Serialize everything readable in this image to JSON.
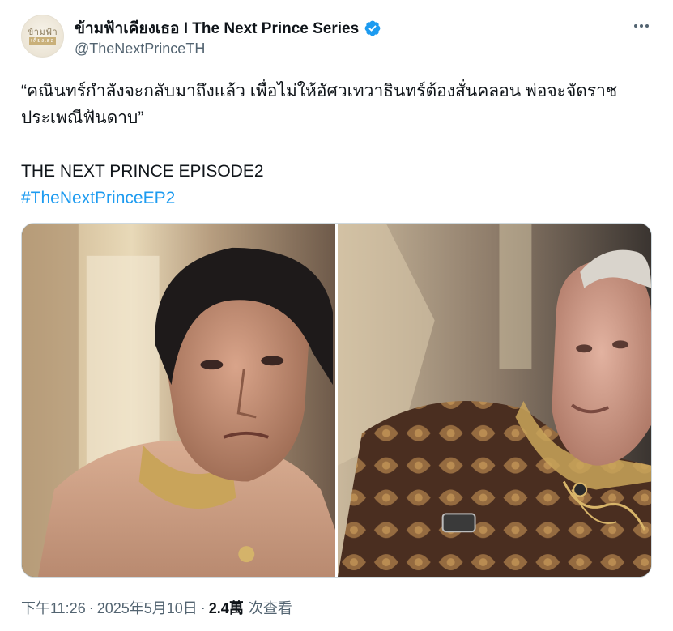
{
  "author": {
    "display_name": "ข้ามฟ้าเคียงเธอ I The Next Prince Series",
    "handle": "@TheNextPrinceTH",
    "avatar_logo_top": "ข้ามฟ้า",
    "avatar_logo_bottom": "เคียงเธอ",
    "verified": true
  },
  "icons": {
    "verified": "verified-badge-icon",
    "more": "more-options-icon"
  },
  "tweet": {
    "line1": "“คณินทร์กำลังจะกลับมาถึงแล้ว เพื่อไม่ให้อัศวเทวาธินทร์ต้องสั่นคลอน พ่อจะจัดราช",
    "line2": "ประเพณีฟันดาบ”",
    "line3": "THE NEXT PRINCE EPISODE2",
    "hashtag": "#TheNextPrinceEP2"
  },
  "media": {
    "left_alt": "Man in peach traditional jacket looking concerned",
    "right_alt": "Elderly man in brown and gold patterned jacket speaking"
  },
  "meta": {
    "time": "下午11:26",
    "date": "2025年5月10日",
    "views_count": "2.4萬",
    "views_label": "次查看",
    "separator": "·"
  },
  "colors": {
    "accent": "#1d9bf0",
    "text_primary": "#0f1419",
    "text_secondary": "#536471"
  }
}
